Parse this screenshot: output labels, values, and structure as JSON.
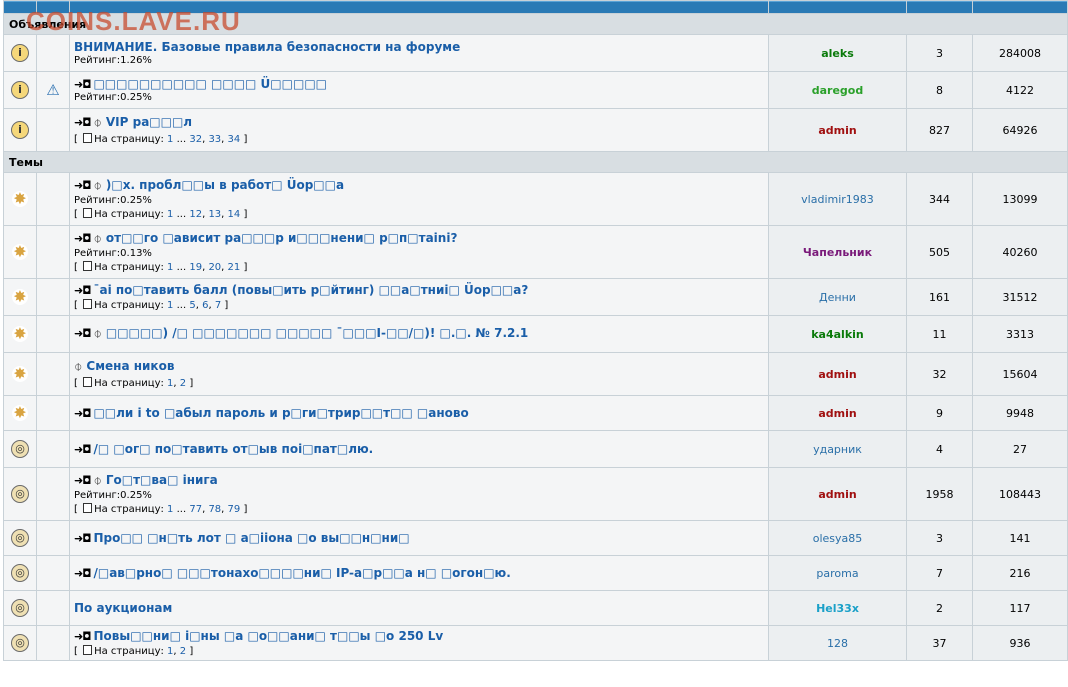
{
  "watermark": "COINS.LAVE.RU",
  "sections": {
    "announcements": "Объявления",
    "topics": "Темы"
  },
  "rows": [
    {
      "title": "ВНИМАНИЕ. Базовые правила безопасности на форуме",
      "prefix": "",
      "clip": false,
      "rating": "Рейтинг:1.26%",
      "pages": null,
      "author": "aleks",
      "author_color": "#0a7a0a",
      "replies": "3",
      "views": "284008",
      "icon1": "info-lock-icon",
      "icon2": ""
    },
    {
      "title": "□□□□□□□□□□ □□□□ Ü□□□□□",
      "prefix": "➜◘",
      "clip": false,
      "rating": "Рейтинг:0.25%",
      "pages": null,
      "author": "daregod",
      "author_color": "#2aa02a",
      "replies": "8",
      "views": "4122",
      "icon1": "info-icon",
      "icon2": "warning-icon"
    },
    {
      "title": "VIP ра□□□л",
      "prefix": "➜◘",
      "clip": true,
      "rating": "",
      "pages": [
        "1",
        "...",
        "32",
        "33",
        "34"
      ],
      "author": "admin",
      "author_color": "#a01010",
      "replies": "827",
      "views": "64926",
      "icon1": "info-dot-icon",
      "icon2": ""
    },
    {
      "title": ")□х. пробл□□ы в работ□ Üор□□а",
      "prefix": "➜◘",
      "clip": true,
      "rating": "Рейтинг:0.25%",
      "pages": [
        "1",
        "...",
        "12",
        "13",
        "14"
      ],
      "author": "vladimir1983",
      "author_color": "#2a6fa8",
      "replies": "344",
      "views": "13099",
      "icon1": "hot-topic-icon",
      "icon2": ""
    },
    {
      "title": "от□□го □авиcит ра□□□р и□□□нени□ р□п□таini?",
      "prefix": "➜◘",
      "clip": true,
      "rating": "Рейтинг:0.13%",
      "pages": [
        "1",
        "...",
        "19",
        "20",
        "21"
      ],
      "author": "Чапельник",
      "author_color": "#7a1a7a",
      "replies": "505",
      "views": "40260",
      "icon1": "hot-topic-icon",
      "icon2": ""
    },
    {
      "title": "¯ai по□тавить балл (повы□ить р□йтинг) □□а□тниi□ Üор□□а?",
      "prefix": "➜◘",
      "clip": false,
      "rating": "",
      "pages": [
        "1",
        "...",
        "5",
        "6",
        "7"
      ],
      "author": "Денни",
      "author_color": "#2a6fa8",
      "replies": "161",
      "views": "31512",
      "icon1": "hot-topic-icon",
      "icon2": ""
    },
    {
      "title": "□□□□□) /□ □□□□□□□ □□□□□ ¯□□□Ⅰ-□□/□)! □.□. № 7.2.1",
      "prefix": "➜◘",
      "clip": true,
      "rating": "",
      "pages": null,
      "author": "ka4alkin",
      "author_color": "#0a7a0a",
      "replies": "11",
      "views": "3313",
      "icon1": "hot-dot-icon",
      "icon2": ""
    },
    {
      "title": "Смена ников",
      "prefix": "",
      "clip": true,
      "rating": "",
      "pages": [
        "1",
        "2"
      ],
      "author": "admin",
      "author_color": "#a01010",
      "replies": "32",
      "views": "15604",
      "icon1": "hot-topic-icon",
      "icon2": ""
    },
    {
      "title": "□□ли i to □абыл пароль и р□ги□трир□□т□□ □аново",
      "prefix": "➜◘",
      "clip": false,
      "rating": "",
      "pages": null,
      "author": "admin",
      "author_color": "#a01010",
      "replies": "9",
      "views": "9948",
      "icon1": "hot-topic-icon",
      "icon2": ""
    },
    {
      "title": "/□ □ог□ по□тавить от□ыв поi□пат□лю.",
      "prefix": "➜◘",
      "clip": false,
      "rating": "",
      "pages": null,
      "author": "ударник",
      "author_color": "#2a6fa8",
      "replies": "4",
      "views": "27",
      "icon1": "topic-icon",
      "icon2": ""
    },
    {
      "title": "Го□т□ва□ iнига",
      "prefix": "➜◘",
      "clip": true,
      "rating": "Рейтинг:0.25%",
      "pages": [
        "1",
        "...",
        "77",
        "78",
        "79"
      ],
      "author": "admin",
      "author_color": "#a01010",
      "replies": "1958",
      "views": "108443",
      "icon1": "topic-icon",
      "icon2": ""
    },
    {
      "title": "Про□□ □н□ть лот □ а□iiона □о вы□□н□ни□",
      "prefix": "➜◘",
      "clip": false,
      "rating": "",
      "pages": null,
      "author": "olesya85",
      "author_color": "#2a6fa8",
      "replies": "3",
      "views": "141",
      "icon1": "topic-icon",
      "icon2": ""
    },
    {
      "title": "/□ав□рно□ □□□тонахо□□□□ни□ IP-а□р□□а н□ □огон□ю.",
      "prefix": "➜◘",
      "clip": false,
      "rating": "",
      "pages": null,
      "author": "paroma",
      "author_color": "#2a6fa8",
      "replies": "7",
      "views": "216",
      "icon1": "topic-icon",
      "icon2": ""
    },
    {
      "title": "По аукционам",
      "prefix": "",
      "clip": false,
      "rating": "",
      "pages": null,
      "author": "Hel33x",
      "author_color": "#1aa0c8",
      "replies": "2",
      "views": "117",
      "icon1": "topic-icon",
      "icon2": ""
    },
    {
      "title": "Повы□□ни□ i□ны □а □о□□ани□ т□□ы □о 250 Lv",
      "prefix": "➜◘",
      "clip": false,
      "rating": "",
      "pages": [
        "1",
        "2"
      ],
      "author": "128",
      "author_color": "#2a6fa8",
      "replies": "37",
      "views": "936",
      "icon1": "topic-icon",
      "icon2": ""
    }
  ],
  "pages_label": "На страницу:"
}
